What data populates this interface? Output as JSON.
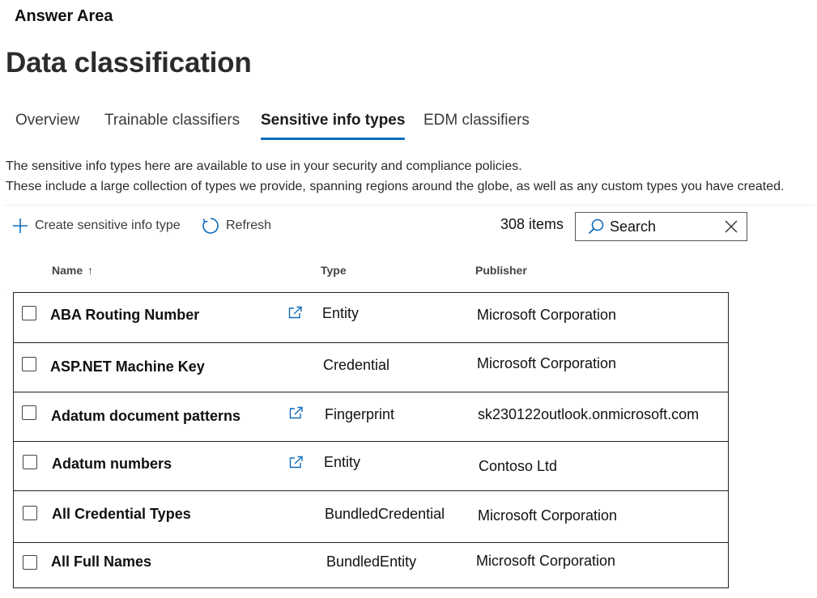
{
  "answer_area": "Answer Area",
  "page_title": "Data classification",
  "tabs": [
    {
      "label": "Overview",
      "active": false
    },
    {
      "label": "Trainable classifiers",
      "active": false
    },
    {
      "label": "Sensitive info types",
      "active": true
    },
    {
      "label": "EDM classifiers",
      "active": false
    }
  ],
  "description": {
    "line1": "The sensitive info types here are available to use in your security and compliance policies.",
    "line2": "These include a large collection of types we provide, spanning regions around the globe, as well as any custom types you have created."
  },
  "toolbar": {
    "create_label": "Create sensitive info type",
    "refresh_label": "Refresh",
    "items_count": "308 items"
  },
  "search": {
    "value": "Search",
    "icon": "search-icon",
    "clear_icon": "close-icon"
  },
  "columns": {
    "name": "Name",
    "name_sort": "↑",
    "type": "Type",
    "publisher": "Publisher"
  },
  "rows": [
    {
      "name": "ABA Routing Number",
      "type": "Entity",
      "publisher": "Microsoft Corporation",
      "has_external_link": true
    },
    {
      "name": "ASP.NET Machine Key",
      "type": "Credential",
      "publisher": "Microsoft Corporation",
      "has_external_link": false
    },
    {
      "name": "Adatum document patterns",
      "type": "Fingerprint",
      "publisher": "sk230122outlook.onmicrosoft.com",
      "has_external_link": true
    },
    {
      "name": "Adatum numbers",
      "type": "Entity",
      "publisher": "Contoso Ltd",
      "has_external_link": true
    },
    {
      "name": "All Credential Types",
      "type": "BundledCredential",
      "publisher": "Microsoft Corporation",
      "has_external_link": false
    },
    {
      "name": "All Full Names",
      "type": "BundledEntity",
      "publisher": "Microsoft Corporation",
      "has_external_link": false
    }
  ],
  "colors": {
    "accent": "#0f6cbd",
    "text": "#1b1b1b"
  }
}
